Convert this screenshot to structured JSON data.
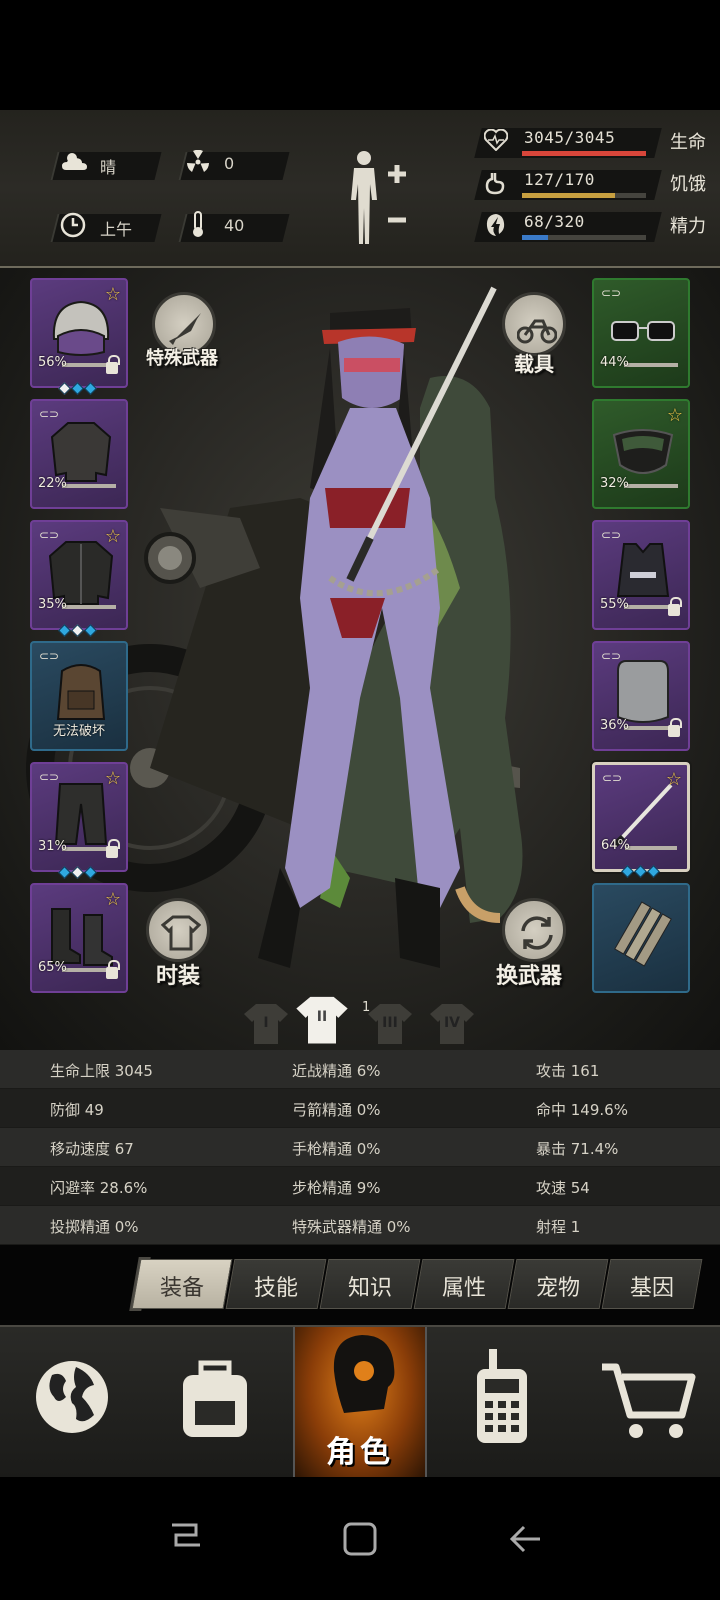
{
  "weather": {
    "condition": "晴",
    "radiation": "0",
    "time_of_day": "上午",
    "temperature": "40"
  },
  "vitals": [
    {
      "icon": "heart-icon",
      "value": "3045/3045",
      "label": "生命",
      "fraction": 1.0,
      "color": "#d8463a"
    },
    {
      "icon": "stomach-icon",
      "value": "127/170",
      "label": "饥饿",
      "fraction": 0.747,
      "color": "#c8a040"
    },
    {
      "icon": "energy-icon",
      "value": "68/320",
      "label": "精力",
      "fraction": 0.2125,
      "color": "#3a7ac8"
    }
  ],
  "equipment": {
    "helmet": {
      "pct": "56%",
      "star": "☆"
    },
    "shirt": {
      "pct": "22%"
    },
    "jacket": {
      "pct": "35%",
      "star": "☆"
    },
    "backpack": {
      "note": "无法破坏"
    },
    "pants": {
      "pct": "31%",
      "star": "☆"
    },
    "boots": {
      "pct": "65%",
      "star": "☆"
    },
    "glasses": {
      "pct": "44%"
    },
    "mask": {
      "pct": "32%",
      "star": "☆"
    },
    "vest": {
      "pct": "55%"
    },
    "shield": {
      "pct": "36%"
    },
    "katana": {
      "pct": "64%",
      "star": "☆"
    },
    "explosive": {}
  },
  "actions": {
    "special_weapon": "特殊武器",
    "vehicle": "载具",
    "fashion": "时装",
    "swap_weapon": "换武器"
  },
  "outfits": {
    "tabs": [
      "I",
      "II",
      "III",
      "IV"
    ],
    "active_number": "1"
  },
  "attributes": [
    [
      "生命上限 3045",
      "近战精通 6%",
      "攻击 161"
    ],
    [
      "防御 49",
      "弓箭精通 0%",
      "命中 149.6%"
    ],
    [
      "移动速度 67",
      "手枪精通 0%",
      "暴击 71.4%"
    ],
    [
      "闪避率 28.6%",
      "步枪精通 9%",
      "攻速 54"
    ],
    [
      "投掷精通 0%",
      "特殊武器精通 0%",
      "射程 1"
    ]
  ],
  "tabs": [
    "装备",
    "技能",
    "知识",
    "属性",
    "宠物",
    "基因"
  ],
  "bottom_nav": {
    "active_label": "角色"
  }
}
